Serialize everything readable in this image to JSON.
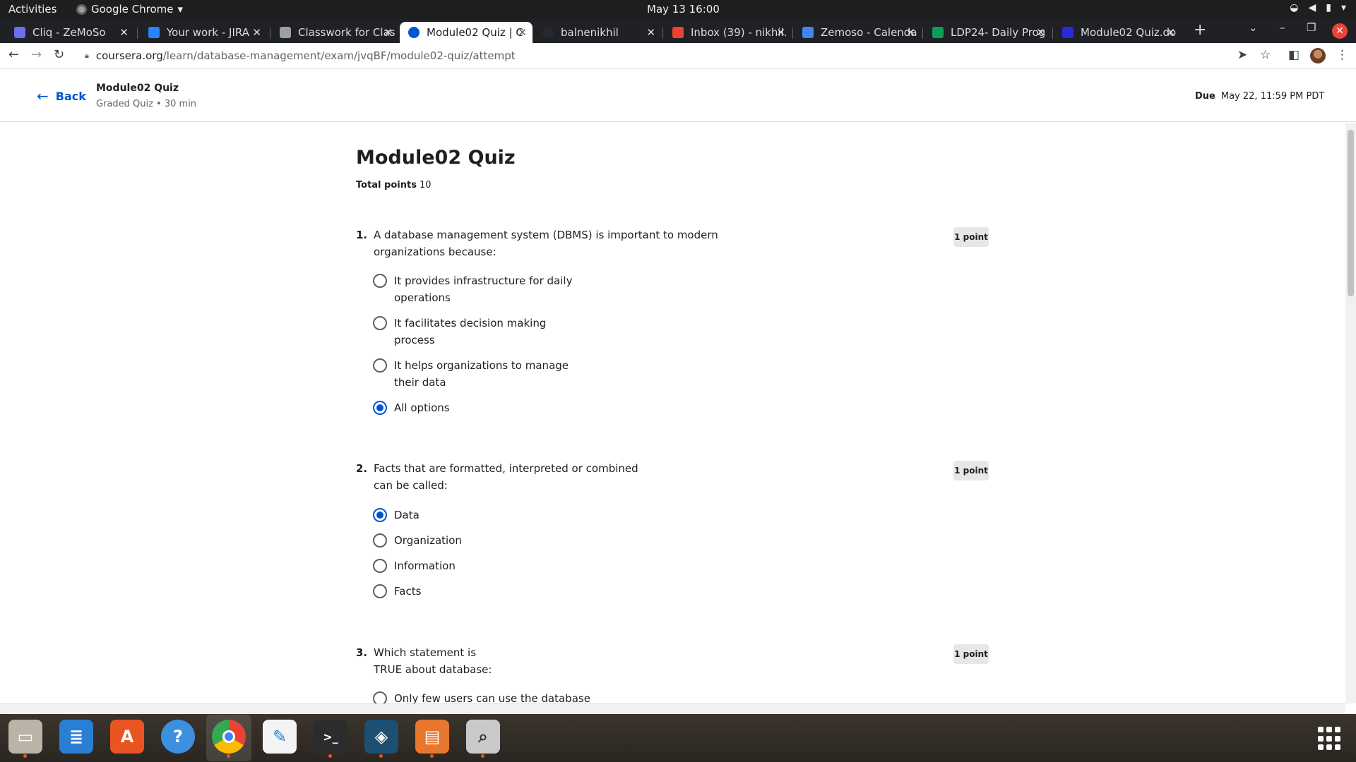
{
  "system": {
    "activities": "Activities",
    "app_name": "Google Chrome",
    "clock": "May 13  16:00"
  },
  "tabs": [
    {
      "title": "Cliq - ZeMoSo",
      "favicon_color": "#6b6ff0",
      "active": false
    },
    {
      "title": "Your work - JIRA",
      "favicon_color": "#2684ff",
      "active": false
    },
    {
      "title": "Classwork for Clas",
      "favicon_color": "#9aa0a6",
      "active": false
    },
    {
      "title": "Module02 Quiz | C",
      "favicon_color": "#0056d2",
      "active": true
    },
    {
      "title": "balnenikhil",
      "favicon_color": "#24292f",
      "active": false
    },
    {
      "title": "Inbox (39) - nikhil.",
      "favicon_color": "#ea4335",
      "active": false
    },
    {
      "title": "Zemoso - Calenda",
      "favicon_color": "#4285f4",
      "active": false
    },
    {
      "title": "LDP24- Daily Prog",
      "favicon_color": "#0f9d58",
      "active": false
    },
    {
      "title": "Module02 Quiz.do",
      "favicon_color": "#2b2bd6",
      "active": false
    }
  ],
  "address_bar": {
    "domain": "coursera.org",
    "path": "/learn/database-management/exam/jvqBF/module02-quiz/attempt"
  },
  "header": {
    "back_label": "Back",
    "title": "Module02 Quiz",
    "subtitle": "Graded Quiz • 30 min",
    "due_label": "Due",
    "due_value": "May 22, 11:59 PM PDT"
  },
  "quiz": {
    "title": "Module02 Quiz",
    "total_label": "Total points",
    "total_value": "10",
    "questions": [
      {
        "number": "1.",
        "text": "A database management system (DBMS) is important to modern organizations because:",
        "points": "1 point",
        "options": [
          {
            "label": "It provides infrastructure for daily operations",
            "selected": false
          },
          {
            "label": "It facilitates decision making process",
            "selected": false
          },
          {
            "label": "It helps organizations to manage their data",
            "selected": false
          },
          {
            "label": "All options",
            "selected": true
          }
        ]
      },
      {
        "number": "2.",
        "text": "Facts that are formatted, interpreted or combined can be called:",
        "points": "1 point",
        "options": [
          {
            "label": "Data",
            "selected": true
          },
          {
            "label": "Organization",
            "selected": false
          },
          {
            "label": "Information",
            "selected": false
          },
          {
            "label": "Facts",
            "selected": false
          }
        ]
      },
      {
        "number": "3.",
        "text": "Which statement is TRUE about database:",
        "points": "1 point",
        "options": [
          {
            "label": "Only few users can use the database",
            "selected": false
          }
        ]
      }
    ]
  },
  "dock": [
    {
      "name": "files-icon",
      "color": "#b9b3a8",
      "glyph": "▭",
      "running": true
    },
    {
      "name": "writer-icon",
      "color": "#2a7fd4",
      "glyph": "≣",
      "running": false
    },
    {
      "name": "app-center-icon",
      "color": "#e95420",
      "glyph": "A",
      "running": false
    },
    {
      "name": "help-icon",
      "color": "#3d8fe0",
      "glyph": "?",
      "running": false
    },
    {
      "name": "chrome-icon",
      "color": "#ffffff",
      "glyph": "",
      "running": true
    },
    {
      "name": "text-editor-icon",
      "color": "#f4f4f4",
      "glyph": "✎",
      "running": false
    },
    {
      "name": "terminal-icon",
      "color": "#2c2c2c",
      "glyph": ">_",
      "running": true
    },
    {
      "name": "mysql-workbench-icon",
      "color": "#1d4f73",
      "glyph": "◈",
      "running": true
    },
    {
      "name": "impress-icon",
      "color": "#e8762c",
      "glyph": "▤",
      "running": true
    },
    {
      "name": "image-viewer-icon",
      "color": "#c9c9c9",
      "glyph": "⌕",
      "running": true
    }
  ]
}
